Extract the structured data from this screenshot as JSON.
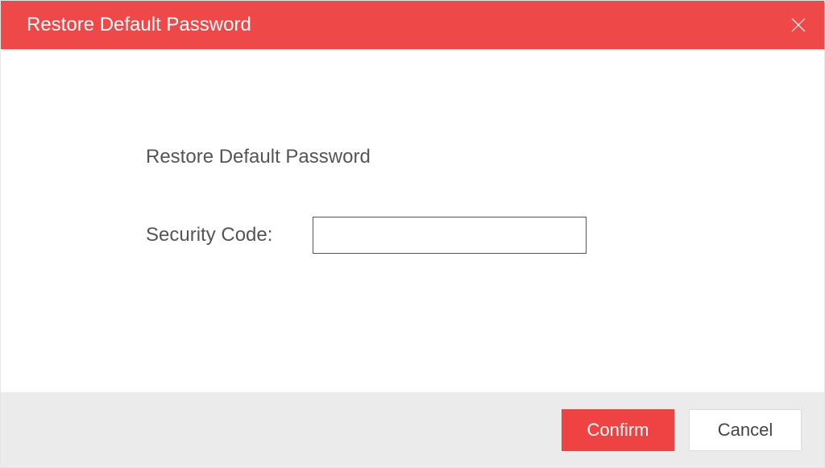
{
  "colors": {
    "accent": "#ef4848",
    "footer_bg": "#ebebeb"
  },
  "title_bar": {
    "title": "Restore Default Password"
  },
  "body": {
    "heading": "Restore Default Password",
    "security_code_label": "Security Code:",
    "security_code_value": ""
  },
  "footer": {
    "confirm_label": "Confirm",
    "cancel_label": "Cancel"
  }
}
